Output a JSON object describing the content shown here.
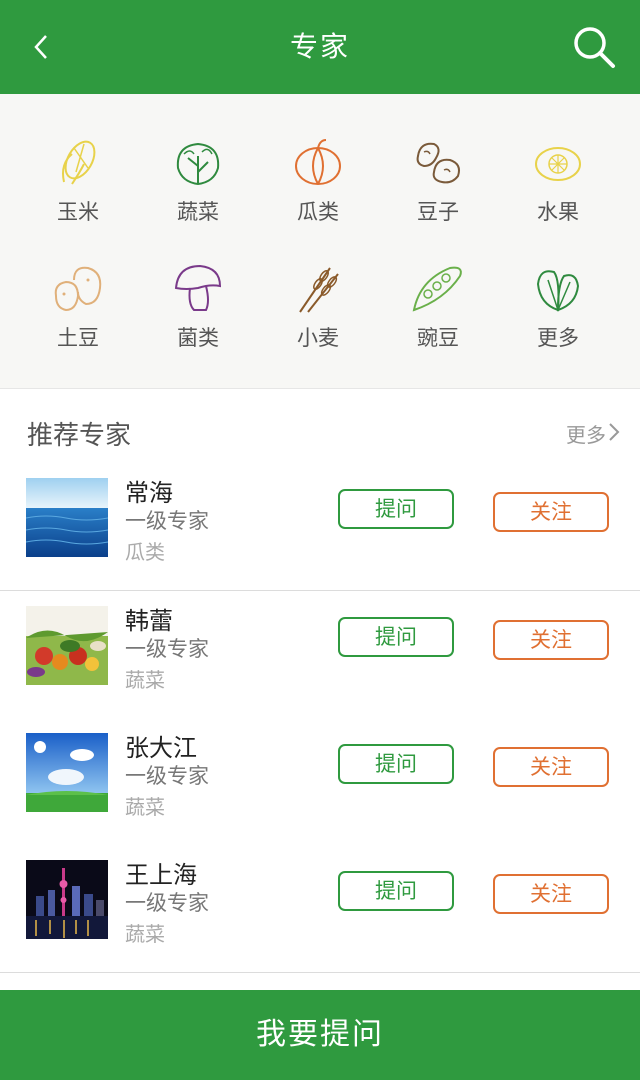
{
  "header": {
    "title": "专家",
    "back_icon": "chevron-left-icon",
    "search_icon": "search-icon"
  },
  "categories": [
    {
      "label": "玉米",
      "icon": "corn-icon",
      "color": "#e8d24a"
    },
    {
      "label": "蔬菜",
      "icon": "lettuce-icon",
      "color": "#2f8a3f"
    },
    {
      "label": "瓜类",
      "icon": "pumpkin-icon",
      "color": "#e07032"
    },
    {
      "label": "豆子",
      "icon": "beans-icon",
      "color": "#7a5a3a"
    },
    {
      "label": "水果",
      "icon": "lemon-icon",
      "color": "#e8d24a"
    },
    {
      "label": "土豆",
      "icon": "potato-icon",
      "color": "#e0b07a"
    },
    {
      "label": "菌类",
      "icon": "mushroom-icon",
      "color": "#7a3a8a"
    },
    {
      "label": "小麦",
      "icon": "wheat-icon",
      "color": "#8a5a2a"
    },
    {
      "label": "豌豆",
      "icon": "pea-pod-icon",
      "color": "#6ab04a"
    },
    {
      "label": "更多",
      "icon": "spinach-icon",
      "color": "#2f8a3f"
    }
  ],
  "recommend": {
    "title": "推荐专家",
    "more": "更多"
  },
  "experts": [
    {
      "name": "常海",
      "level": "一级专家",
      "crop": "瓜类",
      "ask": "提问",
      "follow": "关注",
      "thumb": "ocean-photo"
    },
    {
      "name": "韩蕾",
      "level": "一级专家",
      "crop": "蔬菜",
      "ask": "提问",
      "follow": "关注",
      "thumb": "vegetables-photo"
    },
    {
      "name": "张大江",
      "level": "一级专家",
      "crop": "蔬菜",
      "ask": "提问",
      "follow": "关注",
      "thumb": "meadow-photo"
    },
    {
      "name": "王上海",
      "level": "一级专家",
      "crop": "蔬菜",
      "ask": "提问",
      "follow": "关注",
      "thumb": "city-night-photo"
    }
  ],
  "footer": {
    "label": "我要提问"
  },
  "colors": {
    "primary": "#2f9a3f",
    "follow": "#e07032"
  }
}
